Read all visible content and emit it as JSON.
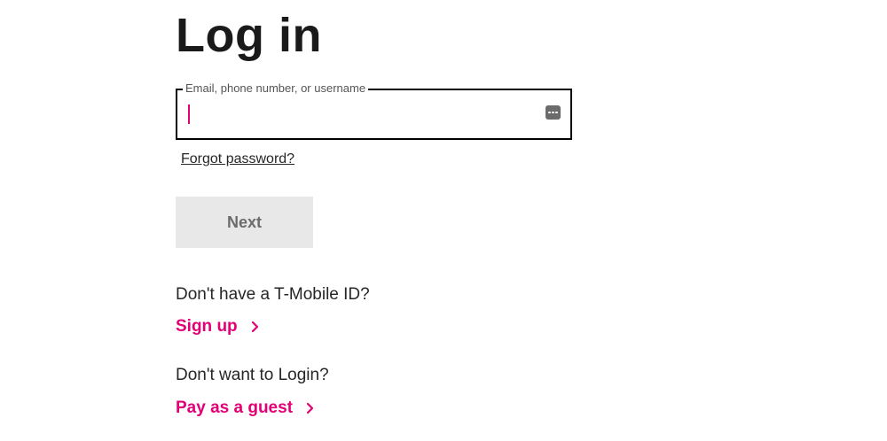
{
  "page": {
    "title": "Log in"
  },
  "login_form": {
    "identifier_label": "Email, phone number, or username",
    "identifier_value": "",
    "forgot_password_label": "Forgot password?",
    "next_label": "Next"
  },
  "signup": {
    "prompt": "Don't have a T-Mobile ID?",
    "link_label": "Sign up"
  },
  "guest": {
    "prompt": "Don't want to Login?",
    "link_label": "Pay as a guest"
  },
  "icons": {
    "password_manager": "password-manager-icon",
    "link_arrow": "chevron-right-icon"
  },
  "colors": {
    "accent": "#e20074",
    "field_border": "#000000",
    "button_disabled_bg": "#e8e8e8",
    "button_disabled_text": "#6b6b6b",
    "text": "#262626"
  }
}
